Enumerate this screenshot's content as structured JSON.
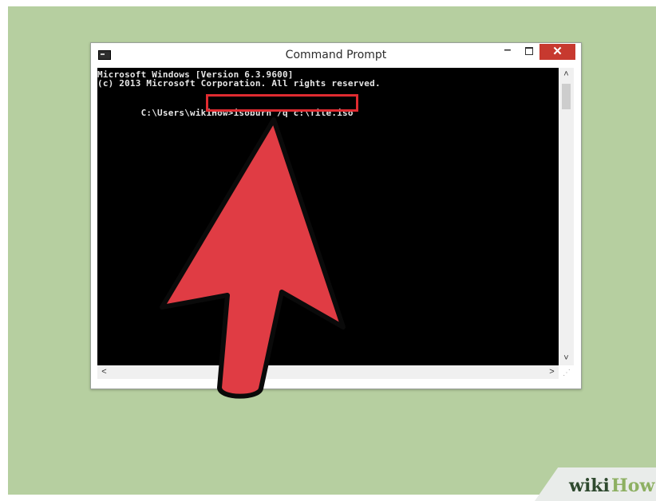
{
  "window": {
    "title": "Command Prompt",
    "icon": "cmd-icon",
    "controls": {
      "minimize": "–",
      "close": "✕"
    }
  },
  "console": {
    "lines": [
      "Microsoft Windows [Version 6.3.9600]",
      "(c) 2013 Microsoft Corporation. All rights reserved.",
      ""
    ],
    "prompt": "C:\\Users\\wikiHow>",
    "command": "isoburn /q c:\\file.iso"
  },
  "scrollbar": {
    "up": "˄",
    "down": "˅",
    "left": "<",
    "right": ">"
  },
  "watermark": {
    "wiki": "wiki",
    "how": "How"
  },
  "colors": {
    "background": "#b6cfa0",
    "console_bg": "#000000",
    "console_text": "#e6e6e6",
    "highlight": "#e02b30",
    "arrow_fill": "#e03c44",
    "close_button": "#c7392f"
  }
}
